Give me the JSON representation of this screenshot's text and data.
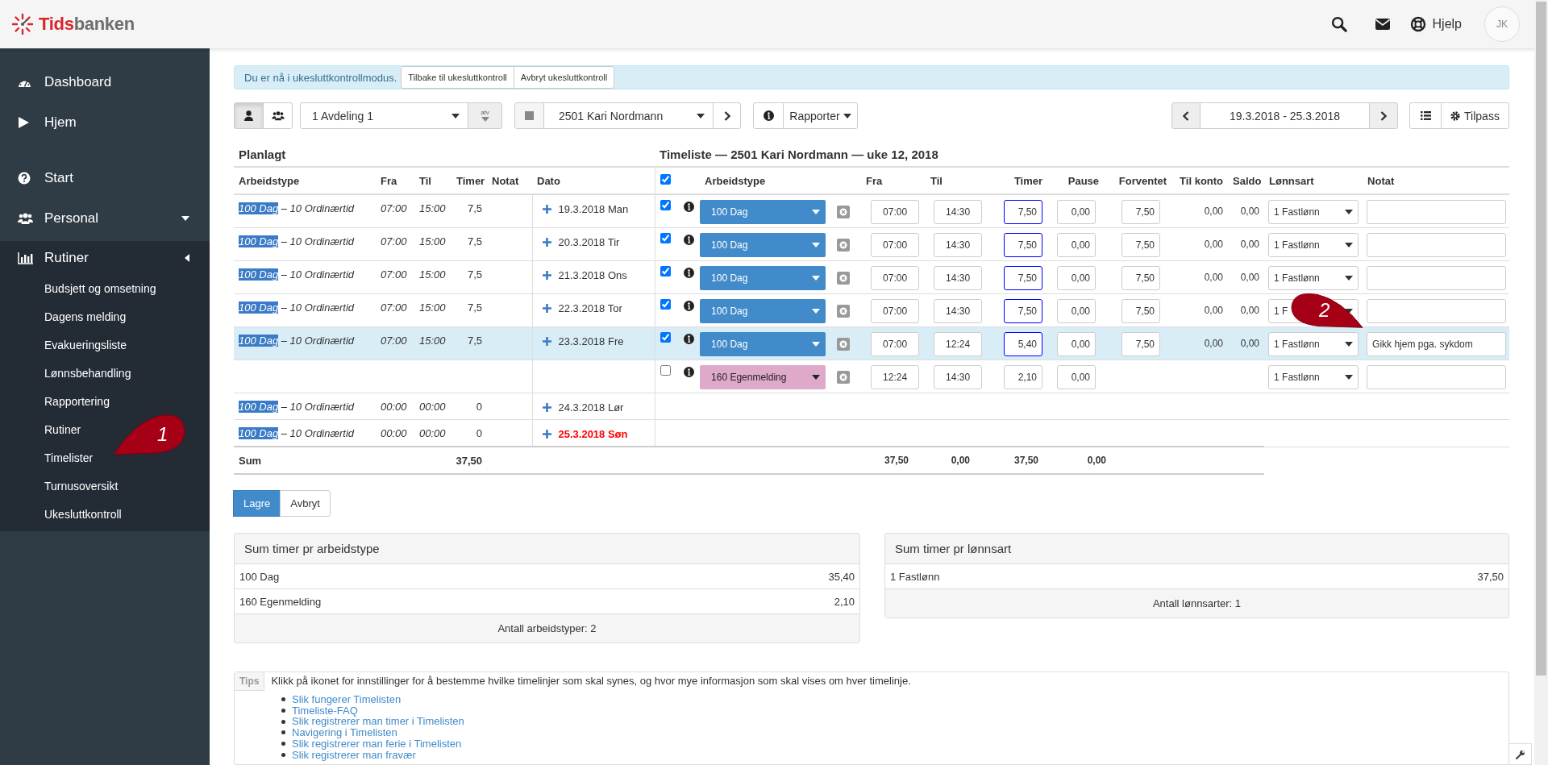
{
  "header": {
    "logo": {
      "part_1": "Tids",
      "part_2": "banken"
    },
    "help_label": "Hjelp",
    "avatar_initials": "JK"
  },
  "sidebar": {
    "items": [
      {
        "label": "Dashboard"
      },
      {
        "label": "Hjem"
      },
      {
        "label": "Start"
      },
      {
        "label": "Personal",
        "expanded": false
      },
      {
        "label": "Rutiner",
        "expanded": true,
        "children": [
          {
            "label": "Budsjett og omsetning"
          },
          {
            "label": "Dagens melding"
          },
          {
            "label": "Evakueringsliste"
          },
          {
            "label": "Lønnsbehandling"
          },
          {
            "label": "Rapportering"
          },
          {
            "label": "Rutiner"
          },
          {
            "label": "Timelister"
          },
          {
            "label": "Turnusoversikt"
          },
          {
            "label": "Ukesluttkontroll"
          }
        ]
      }
    ]
  },
  "alert": {
    "message": "Du er nå i ukesluttkontrollmodus.",
    "buttons": [
      "Tilbake til ukesluttkontroll",
      "Avbryt ukesluttkontroll"
    ]
  },
  "toolbar": {
    "view_buttons": [
      {
        "selected": true
      },
      {
        "selected": false
      }
    ],
    "department": "1 Avdeling 1",
    "sort_label": "atv",
    "employee": "2501 Kari Nordmann",
    "reports_label": "Rapporter",
    "period": "19.3.2018 - 25.3.2018",
    "customize_label": "Tilpass"
  },
  "planned": {
    "title": "Planlagt",
    "columns": [
      "Arbeidstype",
      "Fra",
      "Til",
      "Timer",
      "Notat",
      "Dato"
    ],
    "sum_label": "Sum",
    "sum_hours": "37,50"
  },
  "timesheet": {
    "title": "Timeliste — 2501 Kari Nordmann — uke 12, 2018",
    "all_checked": true,
    "columns": [
      "Arbeidstype",
      "Fra",
      "Til",
      "Timer",
      "Pause",
      "Forventet",
      "Til konto",
      "Saldo",
      "Lønnsart",
      "Notat"
    ],
    "sums": {
      "hours": "37,50",
      "pause": "0,00",
      "expected": "37,50",
      "to_account": "0,00"
    }
  },
  "rows": [
    {
      "highlighted": false,
      "planned": {
        "work_type": "100 Dag",
        "highlighted": true,
        "detail": "– 10 Ordinærtid",
        "from": "07:00",
        "to": "15:00",
        "hours": "7,5",
        "date": "19.3.2018 Man",
        "holiday": false
      },
      "entry": {
        "checked": true,
        "work_type": "100 Dag",
        "color": "#428bca",
        "from": "07:00",
        "to": "14:30",
        "hours": "7,50",
        "modified": true,
        "pause": "0,00",
        "expected": "7,50",
        "to_account": "0,00",
        "balance": "0,00",
        "wage_type": "1 Fastlønn"
      }
    },
    {
      "highlighted": false,
      "planned": {
        "work_type": "100 Dag",
        "highlighted": true,
        "detail": "– 10 Ordinærtid",
        "from": "07:00",
        "to": "15:00",
        "hours": "7,5",
        "date": "20.3.2018 Tir",
        "holiday": false
      },
      "entry": {
        "checked": true,
        "work_type": "100 Dag",
        "color": "#428bca",
        "from": "07:00",
        "to": "14:30",
        "hours": "7,50",
        "modified": true,
        "pause": "0,00",
        "expected": "7,50",
        "to_account": "0,00",
        "balance": "0,00",
        "wage_type": "1 Fastlønn"
      }
    },
    {
      "highlighted": false,
      "planned": {
        "work_type": "100 Dag",
        "highlighted": true,
        "detail": "– 10 Ordinærtid",
        "from": "07:00",
        "to": "15:00",
        "hours": "7,5",
        "date": "21.3.2018 Ons",
        "holiday": false
      },
      "entry": {
        "checked": true,
        "work_type": "100 Dag",
        "color": "#428bca",
        "from": "07:00",
        "to": "14:30",
        "hours": "7,50",
        "modified": true,
        "pause": "0,00",
        "expected": "7,50",
        "to_account": "0,00",
        "balance": "0,00",
        "wage_type": "1 Fastlønn"
      }
    },
    {
      "highlighted": false,
      "planned": {
        "work_type": "100 Dag",
        "highlighted": true,
        "detail": "– 10 Ordinærtid",
        "from": "07:00",
        "to": "15:00",
        "hours": "7,5",
        "date": "22.3.2018 Tor",
        "holiday": false
      },
      "entry": {
        "checked": true,
        "work_type": "100 Dag",
        "color": "#428bca",
        "from": "07:00",
        "to": "14:30",
        "hours": "7,50",
        "modified": true,
        "pause": "0,00",
        "expected": "7,50",
        "to_account": "0,00",
        "balance": "0,00",
        "wage_type": "1 F"
      }
    },
    {
      "highlighted": true,
      "planned": {
        "work_type": "100 Dag",
        "highlighted": true,
        "detail": "– 10 Ordinærtid",
        "from": "07:00",
        "to": "15:00",
        "hours": "7,5",
        "date": "23.3.2018 Fre",
        "holiday": false
      },
      "entry": {
        "checked": true,
        "work_type": "100 Dag",
        "color": "#428bca",
        "from": "07:00",
        "to": "12:24",
        "hours": "5,40",
        "modified": true,
        "pause": "0,00",
        "expected": "7,50",
        "to_account": "0,00",
        "balance": "0,00",
        "wage_type": "1 Fastlønn",
        "note": "Gikk hjem pga. sykdom"
      }
    },
    {
      "highlighted": false,
      "entry": {
        "checked": false,
        "work_type": "160 Egenmelding",
        "color": "#dfa9c9",
        "from": "12:24",
        "to": "14:30",
        "hours": "2,10",
        "modified": false,
        "pause": "0,00",
        "wage_type": "1 Fastlønn"
      }
    },
    {
      "highlighted": false,
      "planned": {
        "work_type": "100 Dag",
        "highlighted": true,
        "detail": "– 10 Ordinærtid",
        "from": "00:00",
        "to": "00:00",
        "hours": "0",
        "date": "24.3.2018 Lør",
        "holiday": false
      }
    },
    {
      "highlighted": false,
      "planned": {
        "work_type": "100 Dag",
        "highlighted": true,
        "detail": "– 10 Ordinærtid",
        "from": "00:00",
        "to": "00:00",
        "hours": "0",
        "date": "25.3.2018 Søn",
        "holiday": true
      }
    }
  ],
  "actions": [
    {
      "label": "Lagre",
      "primary": true
    },
    {
      "label": "Avbryt",
      "primary": false
    }
  ],
  "summaries": [
    {
      "title": "Sum timer pr arbeidstype",
      "rows": [
        {
          "label": "100 Dag",
          "value": "35,40"
        },
        {
          "label": "160 Egenmelding",
          "value": "2,10"
        }
      ],
      "footer": "Antall arbeidstyper: 2"
    },
    {
      "title": "Sum timer pr lønnsart",
      "rows": [
        {
          "label": "1 Fastlønn",
          "value": "37,50"
        }
      ],
      "footer": "Antall lønnsarter: 1"
    }
  ],
  "tips": {
    "label": "Tips",
    "text": "Klikk på ikonet for innstillinger for å bestemme hvilke timelinjer som skal synes, og hvor mye informasjon som skal vises om hver timelinje.",
    "links": [
      "Slik fungerer Timelisten",
      "Timeliste-FAQ",
      "Slik registrerer man timer i Timelisten",
      "Navigering i Timelisten",
      "Slik registrerer man ferie i Timelisten",
      "Slik registrerer man fravær"
    ]
  },
  "callouts": [
    {
      "number": "1"
    },
    {
      "number": "2"
    }
  ]
}
